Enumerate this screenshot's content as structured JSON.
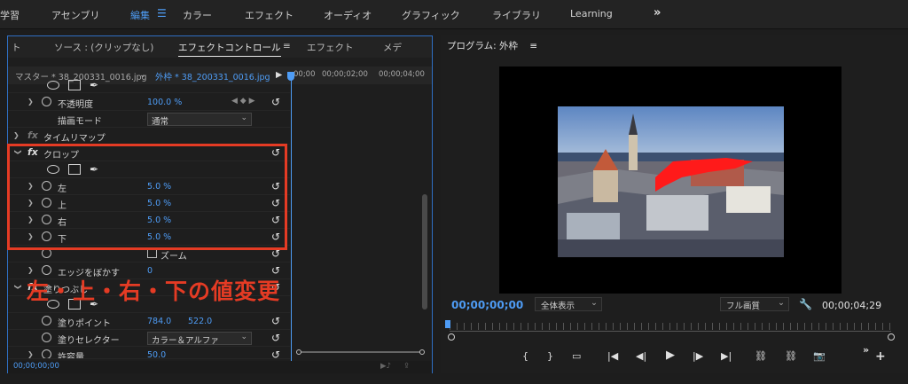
{
  "workspaces": {
    "items": [
      "学習",
      "アセンブリ",
      "編集",
      "カラー",
      "エフェクト",
      "オーディオ",
      "グラフィック",
      "ライブラリ",
      "Learning"
    ],
    "active_index": 2,
    "more": "»"
  },
  "left_panel": {
    "tabs": [
      "ト",
      "ソース : (クリップなし)",
      "エフェクトコントロール",
      "エフェクト",
      "メデ"
    ],
    "active_tab_index": 2,
    "tab_menu": "≡",
    "master_clip": "マスター * 38_200331_0016.jpg",
    "sequence_clip": "外枠 * 38_200331_0016.jpg",
    "ruler": [
      "00;00",
      "00;00;02;00",
      "00;00;04;00"
    ],
    "rows": [
      {
        "label": "不透明度",
        "value": "100.0 %",
        "type": "param"
      },
      {
        "label": "描画モード",
        "value": "通常",
        "type": "dropdown"
      },
      {
        "label": "タイムリマップ",
        "type": "section"
      },
      {
        "label": "クロップ",
        "type": "effect"
      },
      {
        "label": "左",
        "value": "5.0 %",
        "type": "param"
      },
      {
        "label": "上",
        "value": "5.0 %",
        "type": "param"
      },
      {
        "label": "右",
        "value": "5.0 %",
        "type": "param"
      },
      {
        "label": "下",
        "value": "5.0 %",
        "type": "param"
      },
      {
        "label": "エッジをぼかす",
        "value": "0",
        "type": "param",
        "extra": "ズーム"
      },
      {
        "label": "塗りつぶし",
        "type": "effect"
      },
      {
        "label": "塗りポイント",
        "value": "784.0",
        "value2": "522.0",
        "type": "param"
      },
      {
        "label": "塗りセレクター",
        "value": "カラー＆アルファ",
        "type": "dropdown"
      },
      {
        "label": "許容量",
        "value": "50.0",
        "type": "param"
      }
    ],
    "footer_timecode": "00;00;00;00",
    "annotation": "左・上・右・下の値変更"
  },
  "right_panel": {
    "title": "プログラム: 外枠",
    "title_menu": "≡",
    "timecode_current": "00;00;00;00",
    "timecode_duration": "00;00;04;29",
    "fit": "全体表示",
    "quality": "フル画質",
    "transport": [
      "{",
      "}",
      "▭",
      "|◀",
      "◀|",
      "▶",
      "|▶",
      "▶|",
      "lift",
      "extract",
      "camera",
      "»",
      "+"
    ]
  },
  "colors": {
    "accent": "#4e9cf5",
    "highlight": "#e53b24",
    "panel_border": "#2f6fc3"
  }
}
